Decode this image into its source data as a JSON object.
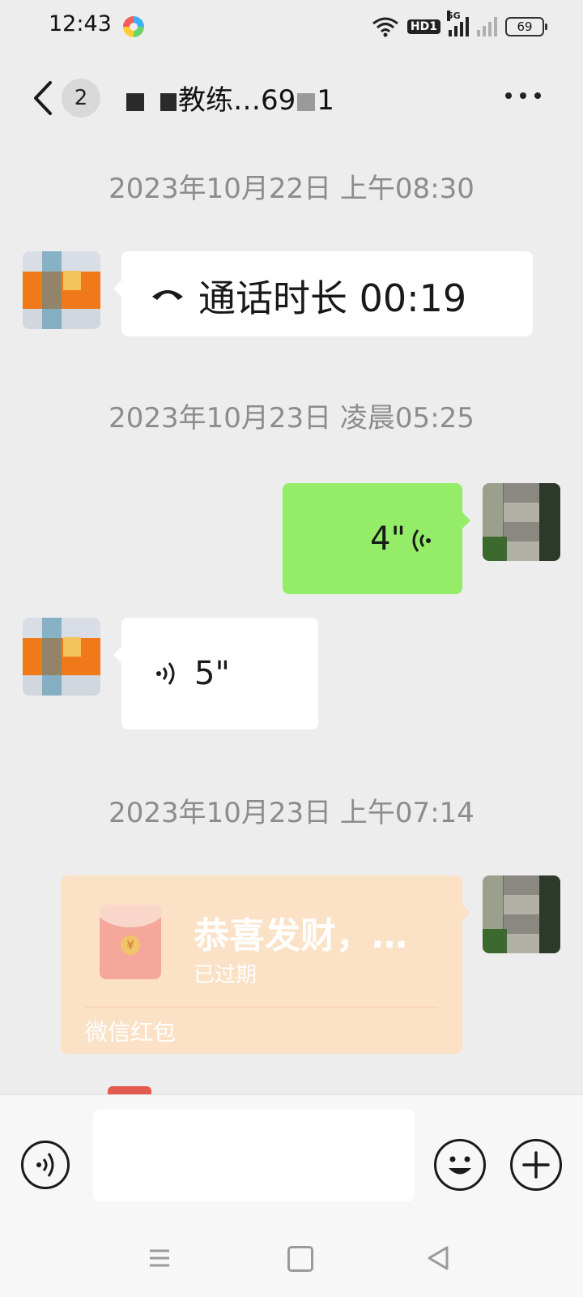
{
  "status_bar": {
    "time": "12:43",
    "network_tag": "HD1",
    "signal_tag": "5G",
    "battery": "69"
  },
  "header": {
    "unread_count": "2",
    "title": "教练…69",
    "title_tail": "1"
  },
  "messages": [
    {
      "type": "timestamp",
      "text": "2023年10月22日 上午08:30"
    },
    {
      "type": "call",
      "side": "left",
      "icon": "phone-hangup-icon",
      "text": "通话时长 00:19"
    },
    {
      "type": "timestamp",
      "text": "2023年10月23日 凌晨05:25"
    },
    {
      "type": "voice",
      "side": "right",
      "duration": "4\""
    },
    {
      "type": "voice",
      "side": "left",
      "duration": "5\""
    },
    {
      "type": "timestamp",
      "text": "2023年10月23日 上午07:14"
    },
    {
      "type": "red_packet",
      "side": "right",
      "title": "恭喜发财，…",
      "status": "已过期",
      "label": "微信红包"
    }
  ],
  "colors": {
    "background": "#ededed",
    "sent_bubble": "#95ec69",
    "received_bubble": "#ffffff",
    "red_packet": "#fbe1c6"
  }
}
